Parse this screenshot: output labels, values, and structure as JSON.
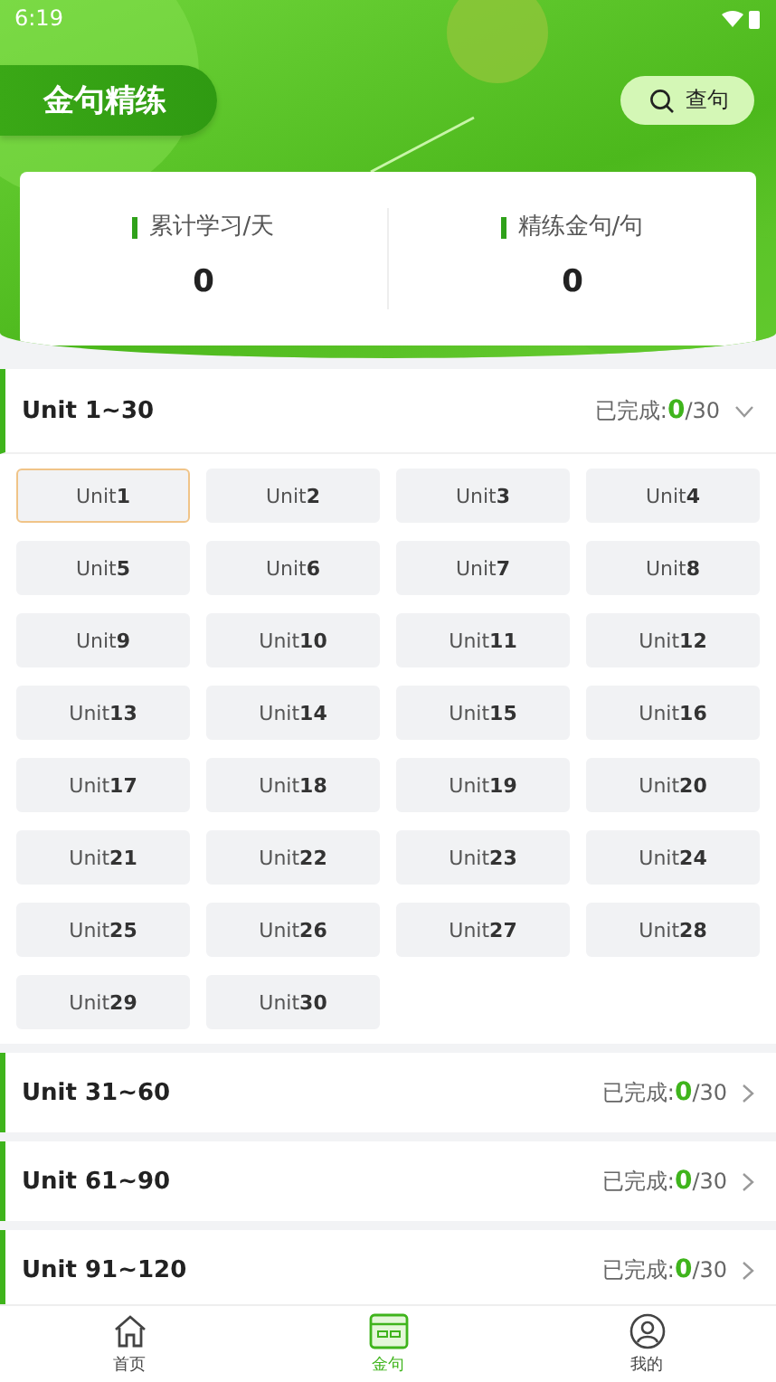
{
  "status_bar": {
    "time": "6:19"
  },
  "header": {
    "title": "金句精练",
    "search_button": "查句"
  },
  "stats": [
    {
      "label": "累计学习/天",
      "value": "0"
    },
    {
      "label": "精练金句/句",
      "value": "0"
    }
  ],
  "sections": [
    {
      "title": "Unit 1~30",
      "progress": "已完成:**0**/30",
      "expanded": true,
      "units": [
        {
          "label": "Unit**1**",
          "selected": true
        },
        {
          "label": "Unit**2**",
          "selected": false
        },
        {
          "label": "Unit**3**",
          "selected": false
        },
        {
          "label": "Unit**4**",
          "selected": false
        },
        {
          "label": "Unit**5**",
          "selected": false
        },
        {
          "label": "Unit**6**",
          "selected": false
        },
        {
          "label": "Unit**7**",
          "selected": false
        },
        {
          "label": "Unit**8**",
          "selected": false
        },
        {
          "label": "Unit**9**",
          "selected": false
        },
        {
          "label": "Unit**10**",
          "selected": false
        },
        {
          "label": "Unit**11**",
          "selected": false
        },
        {
          "label": "Unit**12**",
          "selected": false
        },
        {
          "label": "Unit**13**",
          "selected": false
        },
        {
          "label": "Unit**14**",
          "selected": false
        },
        {
          "label": "Unit**15**",
          "selected": false
        },
        {
          "label": "Unit**16**",
          "selected": false
        },
        {
          "label": "Unit**17**",
          "selected": false
        },
        {
          "label": "Unit**18**",
          "selected": false
        },
        {
          "label": "Unit**19**",
          "selected": false
        },
        {
          "label": "Unit**20**",
          "selected": false
        },
        {
          "label": "Unit**21**",
          "selected": false
        },
        {
          "label": "Unit**22**",
          "selected": false
        },
        {
          "label": "Unit**23**",
          "selected": false
        },
        {
          "label": "Unit**24**",
          "selected": false
        },
        {
          "label": "Unit**25**",
          "selected": false
        },
        {
          "label": "Unit**26**",
          "selected": false
        },
        {
          "label": "Unit**27**",
          "selected": false
        },
        {
          "label": "Unit**28**",
          "selected": false
        },
        {
          "label": "Unit**29**",
          "selected": false
        },
        {
          "label": "Unit**30**",
          "selected": false
        }
      ]
    },
    {
      "title": "Unit 31~60",
      "progress": "已完成:**0**/30",
      "expanded": false
    },
    {
      "title": "Unit 61~90",
      "progress": "已完成:**0**/30",
      "expanded": false
    },
    {
      "title": "Unit 91~120",
      "progress": "已完成:**0**/30",
      "expanded": false
    }
  ],
  "nav": [
    {
      "label": "首页",
      "kind": "home",
      "selected": false
    },
    {
      "label": "金句",
      "kind": "card",
      "selected": true
    },
    {
      "label": "我的",
      "kind": "user",
      "selected": false
    }
  ]
}
